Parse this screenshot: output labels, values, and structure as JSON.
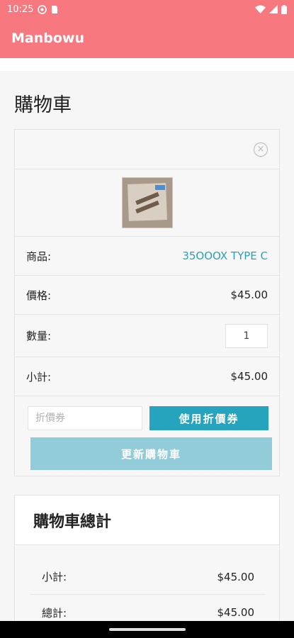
{
  "status_bar": {
    "time": "10:25"
  },
  "app_bar": {
    "title": "Manbowu"
  },
  "page": {
    "title": "購物車"
  },
  "cart_item": {
    "remove_glyph": "×",
    "product_label": "商品:",
    "product_name": "35OOOX TYPE C",
    "price_label": "價格:",
    "price": "$45.00",
    "quantity_label": "數量:",
    "quantity": "1",
    "subtotal_label": "小計:",
    "subtotal": "$45.00"
  },
  "coupon": {
    "placeholder": "折價券",
    "apply_label": "使用折價券",
    "update_cart_label": "更新購物車"
  },
  "totals": {
    "heading": "購物車總計",
    "subtotal_label": "小計:",
    "subtotal": "$45.00",
    "total_label": "總計:",
    "total": "$45.00"
  },
  "colors": {
    "brand": "#f7787e",
    "accent": "#26a3bd",
    "accent_light": "#93ccd9",
    "link": "#2aa0b5"
  },
  "icons": [
    "settings-status-icon",
    "sim-card-icon",
    "wifi-icon",
    "signal-icon",
    "battery-icon",
    "remove-item-icon"
  ]
}
